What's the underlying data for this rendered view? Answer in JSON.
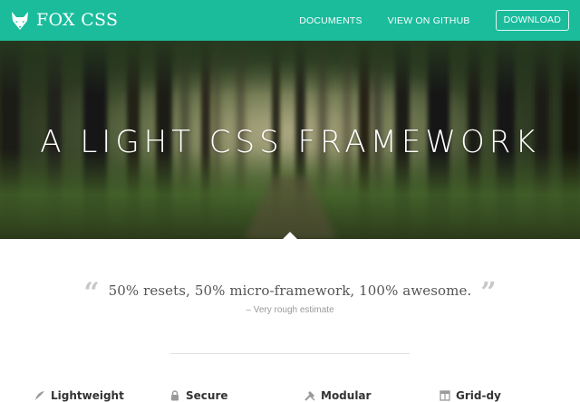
{
  "brand": {
    "name": "FOX CSS",
    "logo_icon": "fox-head-icon"
  },
  "nav": {
    "documents": "DOCUMENTS",
    "github": "VIEW ON GITHUB",
    "download": "DOWNLOAD"
  },
  "hero": {
    "title": "A LIGHT CSS FRAMEWORK",
    "background": "blurred forest photo"
  },
  "quote": {
    "text": "50% resets, 50% micro-framework, 100% awesome.",
    "source": "– Very rough estimate"
  },
  "features": [
    {
      "label": "Lightweight",
      "icon": "feather-icon"
    },
    {
      "label": "Secure",
      "icon": "lock-icon"
    },
    {
      "label": "Modular",
      "icon": "tools-icon"
    },
    {
      "label": "Grid-dy",
      "icon": "grid-icon"
    }
  ],
  "colors": {
    "accent": "#1abc9c",
    "text": "#555555",
    "muted": "#9a9a9a"
  }
}
